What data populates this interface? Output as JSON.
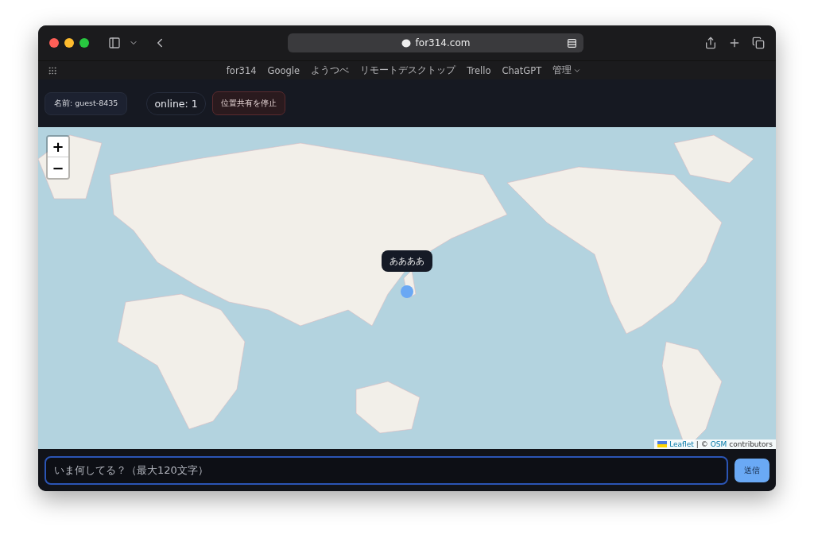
{
  "browser": {
    "url": "for314.com",
    "bookmarks": [
      {
        "label": "for314",
        "kind": "link"
      },
      {
        "label": "Google",
        "kind": "link"
      },
      {
        "label": "ようつべ",
        "kind": "link"
      },
      {
        "label": "リモートデスクトップ",
        "kind": "link"
      },
      {
        "label": "Trello",
        "kind": "link"
      },
      {
        "label": "ChatGPT",
        "kind": "link"
      },
      {
        "label": "管理",
        "kind": "menu"
      }
    ]
  },
  "header": {
    "name_badge": "名前: guest-8435",
    "online_badge": "online: 1",
    "stop_button": "位置共有を停止"
  },
  "map": {
    "zoom_in": "+",
    "zoom_out": "−",
    "markers": [
      {
        "label": "ああああ"
      }
    ],
    "attribution": {
      "leaflet": "Leaflet",
      "separator": "| ©",
      "osm": "OSM",
      "suffix": "contributors"
    }
  },
  "composer": {
    "placeholder": "いま何してる？（最大120文字）",
    "send_button": "送信"
  }
}
